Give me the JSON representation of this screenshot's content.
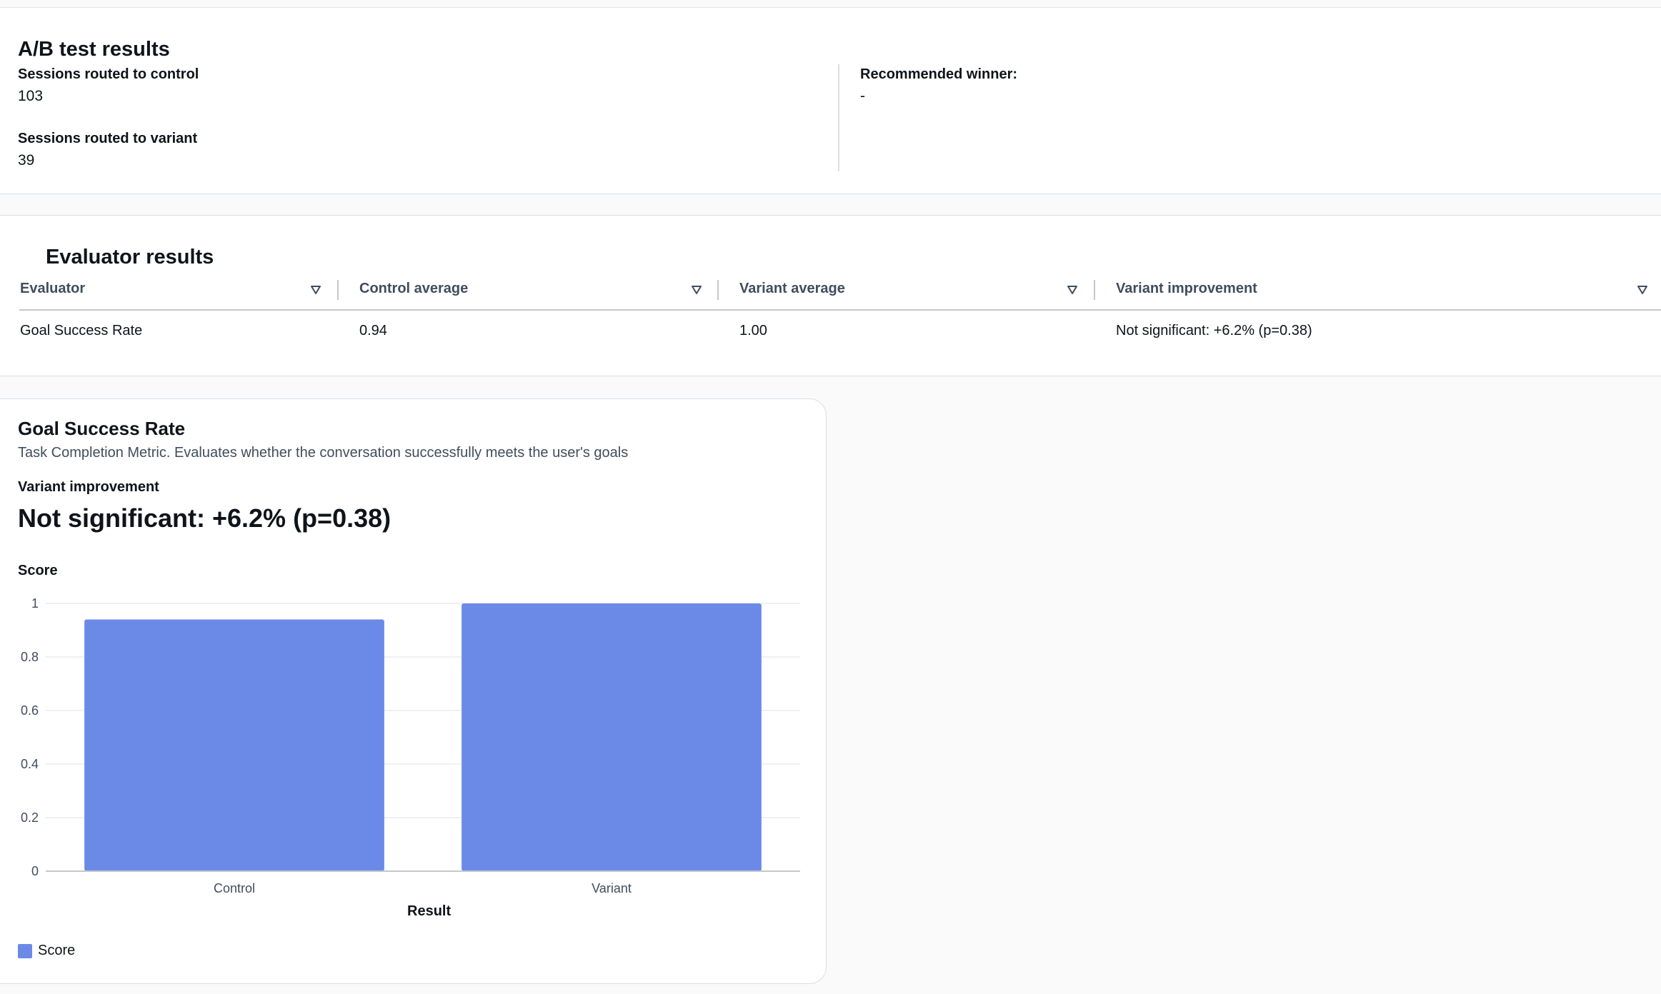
{
  "ab_test": {
    "title": "A/B test results",
    "control_label": "Sessions routed to control",
    "control_value": "103",
    "variant_label": "Sessions routed to variant",
    "variant_value": "39",
    "winner_label": "Recommended winner:",
    "winner_value": "-"
  },
  "evaluator": {
    "title": "Evaluator results",
    "columns": [
      "Evaluator",
      "Control average",
      "Variant average",
      "Variant improvement"
    ],
    "rows": [
      [
        "Goal Success Rate",
        "0.94",
        "1.00",
        "Not significant: +6.2% (p=0.38)"
      ]
    ]
  },
  "goal_success": {
    "title": "Goal Success Rate",
    "description": "Task Completion Metric. Evaluates whether the conversation successfully meets the user's goals",
    "improvement_label": "Variant improvement",
    "improvement_value": "Not significant: +6.2% (p=0.38)"
  },
  "chart_data": {
    "type": "bar",
    "categories": [
      "Control",
      "Variant"
    ],
    "series": [
      {
        "name": "Score",
        "values": [
          0.94,
          1.0
        ]
      }
    ],
    "ylabel": "Score",
    "xlabel": "Result",
    "ylim": [
      0,
      1
    ],
    "yticks": [
      "1",
      "0.8",
      "0.6",
      "0.4",
      "0.2",
      "0"
    ],
    "ytick_values": [
      1,
      0.8,
      0.6,
      0.4,
      0.2,
      0
    ],
    "grid": true,
    "legend": "bottom-left",
    "bar_color": "#6b8ae8"
  },
  "colors": {
    "bar": "#6b8ae8",
    "gridline": "#e9ebed",
    "axis": "#c6c6cd"
  }
}
